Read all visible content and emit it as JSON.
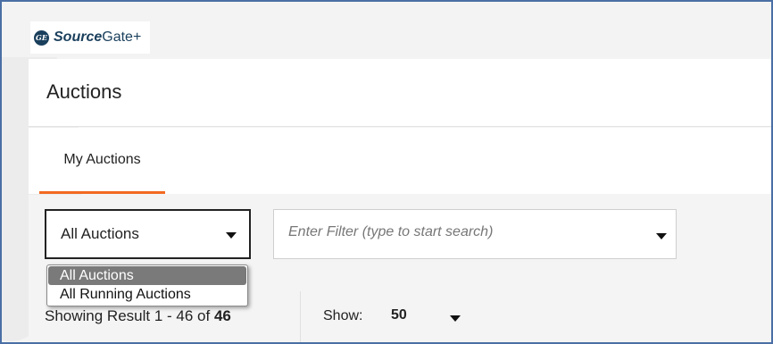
{
  "brand": {
    "logo_mark": "GE",
    "name_bold": "Source",
    "name_plain": "Gate+"
  },
  "page": {
    "title": "Auctions"
  },
  "tabs": [
    {
      "label": "My Auctions",
      "active": true
    }
  ],
  "filter": {
    "selected": "All Auctions",
    "placeholder": "Enter Filter (type to start search)"
  },
  "dropdown": {
    "options": [
      "All Auctions",
      "All Running Auctions"
    ],
    "highlighted": "All Auctions"
  },
  "results": {
    "prefix": "Showing Result",
    "range": "1 - 46 of",
    "total": "46"
  },
  "pagination": {
    "show_label": "Show:",
    "page_size": "50"
  },
  "colors": {
    "tab_underline": "#f26a21",
    "brand": "#1a3f5c"
  },
  "icons": {
    "logo": "ge-monogram-icon",
    "select_caret": "caret-down-icon"
  }
}
